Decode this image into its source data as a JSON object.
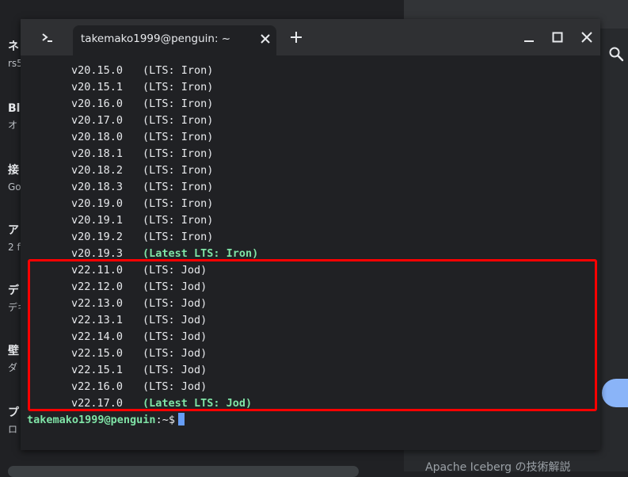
{
  "background": {
    "items": [
      {
        "title": "ネ",
        "sub": "rs5"
      },
      {
        "title": "Bl",
        "sub": "オ"
      },
      {
        "title": "接",
        "sub": "Go"
      },
      {
        "title": "ア",
        "sub": "2 f"
      },
      {
        "title": "デ",
        "sub": "デキ"
      },
      {
        "title": "壁",
        "sub": "ダ"
      },
      {
        "title": "プ",
        "sub": "ロ"
      }
    ],
    "bottom_text": "Apache Iceberg の技術解説"
  },
  "terminal": {
    "tab_title": "takemako1999@penguin: ~",
    "lines": [
      {
        "version": "v20.15.0",
        "lts": "(LTS: Iron)",
        "latest": false
      },
      {
        "version": "v20.15.1",
        "lts": "(LTS: Iron)",
        "latest": false
      },
      {
        "version": "v20.16.0",
        "lts": "(LTS: Iron)",
        "latest": false
      },
      {
        "version": "v20.17.0",
        "lts": "(LTS: Iron)",
        "latest": false
      },
      {
        "version": "v20.18.0",
        "lts": "(LTS: Iron)",
        "latest": false
      },
      {
        "version": "v20.18.1",
        "lts": "(LTS: Iron)",
        "latest": false
      },
      {
        "version": "v20.18.2",
        "lts": "(LTS: Iron)",
        "latest": false
      },
      {
        "version": "v20.18.3",
        "lts": "(LTS: Iron)",
        "latest": false
      },
      {
        "version": "v20.19.0",
        "lts": "(LTS: Iron)",
        "latest": false
      },
      {
        "version": "v20.19.1",
        "lts": "(LTS: Iron)",
        "latest": false
      },
      {
        "version": "v20.19.2",
        "lts": "(LTS: Iron)",
        "latest": false
      },
      {
        "version": "v20.19.3",
        "lts": "(Latest LTS: Iron)",
        "latest": true
      },
      {
        "version": "v22.11.0",
        "lts": "(LTS: Jod)",
        "latest": false
      },
      {
        "version": "v22.12.0",
        "lts": "(LTS: Jod)",
        "latest": false
      },
      {
        "version": "v22.13.0",
        "lts": "(LTS: Jod)",
        "latest": false
      },
      {
        "version": "v22.13.1",
        "lts": "(LTS: Jod)",
        "latest": false
      },
      {
        "version": "v22.14.0",
        "lts": "(LTS: Jod)",
        "latest": false
      },
      {
        "version": "v22.15.0",
        "lts": "(LTS: Jod)",
        "latest": false
      },
      {
        "version": "v22.15.1",
        "lts": "(LTS: Jod)",
        "latest": false
      },
      {
        "version": "v22.16.0",
        "lts": "(LTS: Jod)",
        "latest": false
      },
      {
        "version": "v22.17.0",
        "lts": "(Latest LTS: Jod)",
        "latest": true
      }
    ],
    "prompt_user": "takemako1999@penguin",
    "prompt_rest": ":~$"
  },
  "colors": {
    "green_text": "#7fe3a6",
    "highlight": "#ff0000",
    "cursor": "#669df6"
  },
  "icons": {
    "launcher": "terminal-prompt-icon",
    "tab_close": "close-icon",
    "new_tab": "plus-icon",
    "minimize": "minimize-icon",
    "maximize": "maximize-icon",
    "close": "close-icon",
    "search": "search-icon"
  }
}
